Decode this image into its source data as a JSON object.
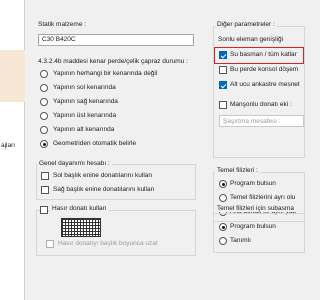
{
  "left_panel": {
    "selected_item_fragment": "ajları"
  },
  "static_material": {
    "label": "Statik malzeme :",
    "value": "C30 B420C"
  },
  "rule": {
    "title": "4.3.2.4b maddesi kenar perde/çelik çapraz durumu :",
    "options": [
      {
        "label": "Yapının herhangi bir kenarında değil",
        "selected": false
      },
      {
        "label": "Yapının sol kenarında",
        "selected": false
      },
      {
        "label": "Yapının sağ kenarında",
        "selected": false
      },
      {
        "label": "Yapının üst kenarında",
        "selected": false
      },
      {
        "label": "Yapının alt kenarında",
        "selected": false
      },
      {
        "label": "Geometriden otomatik belirle",
        "selected": true
      }
    ]
  },
  "bearing": {
    "title": "Genel dayanımı hesabı :",
    "options": [
      {
        "label": "Sol başlık enine donatılarını kullan",
        "checked": false
      },
      {
        "label": "Sağ başlık enine donatılarını kullan",
        "checked": false
      }
    ]
  },
  "mesh": {
    "label": "Hasır donatı kullan",
    "sub_label": "Hasır donatıyı başlık boyunca uzat"
  },
  "other": {
    "title": "Diğer parametreler :",
    "last_element_label": "Sonlu eleman genişliği",
    "checks": [
      {
        "label": "Su basman / tüm katlar",
        "checked": true
      },
      {
        "label": "Bu perde konsol döşem",
        "checked": false
      },
      {
        "label": "Alt ucu ankastre mesnet",
        "checked": true
      }
    ],
    "manson_label": "Manşonlu donatı eki :",
    "spacing_placeholder": "Şaşırtma mesafesi :"
  },
  "footing": {
    "title": "Temel filizleri :",
    "options": [
      {
        "label": "Program bulsun",
        "selected": true
      },
      {
        "label": "Temel filizlerini ayrı olu",
        "selected": false
      },
      {
        "label": "Ana donatı ile aynı yap",
        "selected": false
      }
    ]
  },
  "footing2": {
    "title": "Temel filizleri için subasma",
    "options": [
      {
        "label": "Program bulsun",
        "selected": true
      },
      {
        "label": "Tanımlı",
        "selected": false
      }
    ]
  },
  "colors": {
    "highlight": "#e02020",
    "accent": "#0067c0",
    "selection": "#f8e6d4"
  }
}
